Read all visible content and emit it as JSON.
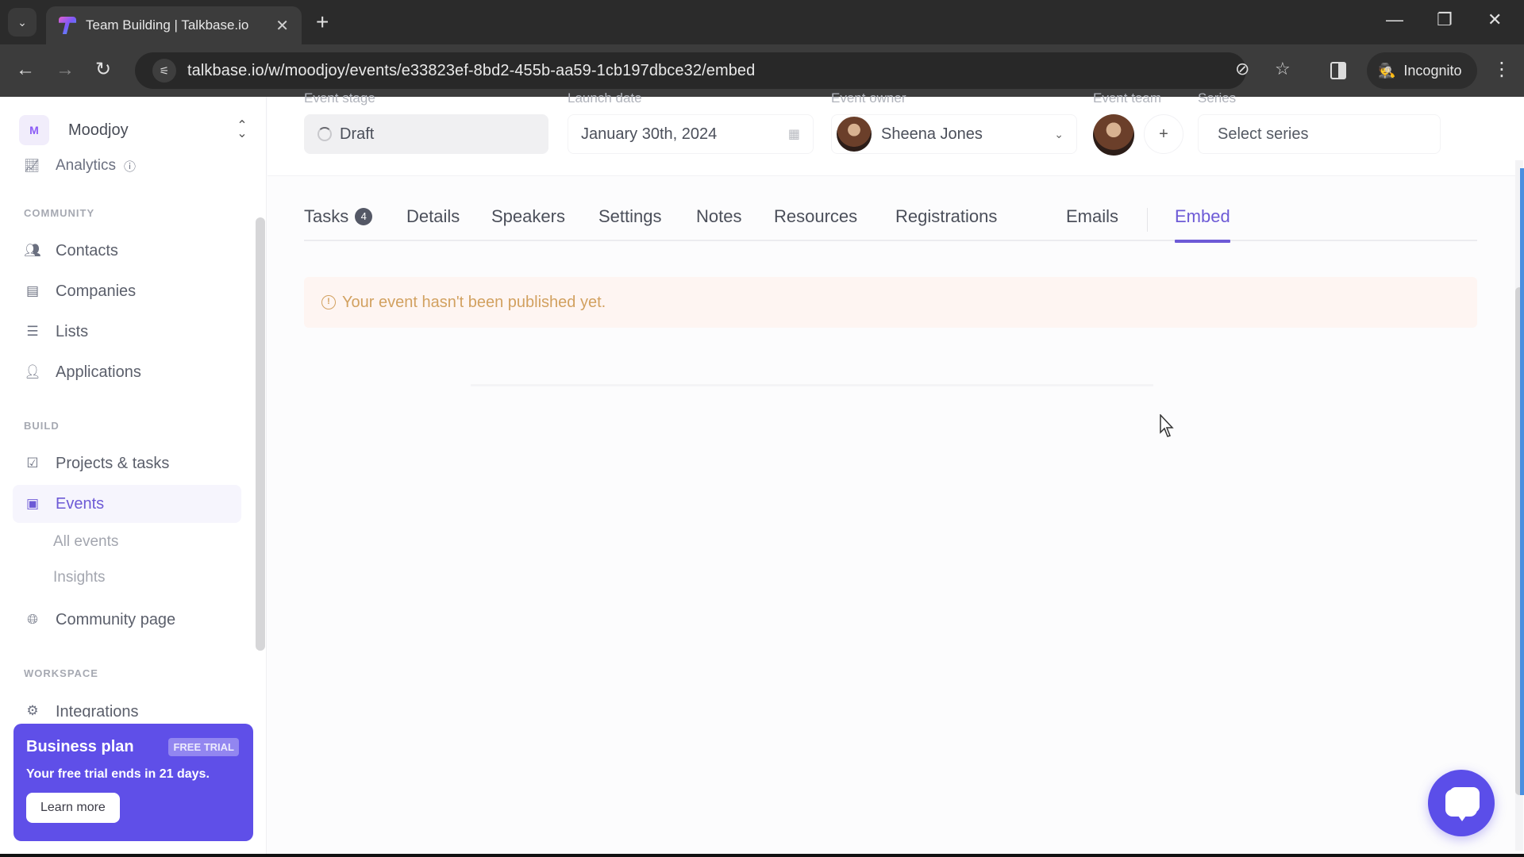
{
  "browser": {
    "tab_title": "Team Building | Talkbase.io",
    "url": "talkbase.io/w/moodjoy/events/e33823ef-8bd2-455b-aa59-1cb197dbce32/embed",
    "incognito_label": "Incognito",
    "icons": {
      "tab_search": "chevron-down-icon",
      "new_tab": "plus-icon",
      "back": "arrow-left-icon",
      "forward": "arrow-right-icon",
      "reload": "reload-icon",
      "site_info": "tune-icon",
      "eye_off": "eye-off-icon",
      "bookmark": "star-icon",
      "side_panel": "side-panel-icon",
      "menu": "more-vertical-icon"
    }
  },
  "sidebar": {
    "workspace": {
      "initial": "M",
      "name": "Moodjoy"
    },
    "analytics_label": "Analytics",
    "sections": {
      "community": "COMMUNITY",
      "build": "BUILD",
      "workspace": "WORKSPACE"
    },
    "community_items": [
      {
        "label": "Contacts",
        "icon": "users-icon"
      },
      {
        "label": "Companies",
        "icon": "book-icon"
      },
      {
        "label": "Lists",
        "icon": "list-icon"
      },
      {
        "label": "Applications",
        "icon": "user-plus-icon"
      }
    ],
    "build_items": [
      {
        "label": "Projects & tasks",
        "icon": "check-square-icon"
      },
      {
        "label": "Events",
        "icon": "calendar-icon",
        "active": true
      },
      {
        "label": "Community page",
        "icon": "globe-icon"
      }
    ],
    "events_subitems": [
      "All events",
      "Insights"
    ],
    "workspace_items": [
      {
        "label": "Integrations",
        "icon": "plug-icon"
      }
    ],
    "trial": {
      "title": "Business plan",
      "badge": "FREE TRIAL",
      "text": "Your free trial ends in 21 days.",
      "button": "Learn more"
    }
  },
  "event_header": {
    "labels": {
      "stage": "Event stage",
      "launch_date": "Launch date",
      "owner": "Event owner",
      "team": "Event team",
      "series": "Series"
    },
    "stage": "Draft",
    "launch_date": "January 30th, 2024",
    "owner": "Sheena Jones",
    "series_placeholder": "Select series",
    "add_team_label": "+"
  },
  "tabs": [
    {
      "label": "Tasks",
      "badge": "4"
    },
    {
      "label": "Details"
    },
    {
      "label": "Speakers"
    },
    {
      "label": "Settings"
    },
    {
      "label": "Notes"
    },
    {
      "label": "Resources"
    },
    {
      "label": "Registrations"
    },
    {
      "label": "Emails"
    },
    {
      "label": "Embed",
      "active": true
    }
  ],
  "alert": {
    "icon_glyph": "!",
    "text": "Your event hasn't been published yet."
  },
  "colors": {
    "accent": "#6d5ad6",
    "trial_bg": "#5f4fe8",
    "alert_text": "#d2a160",
    "alert_bg": "#fef5f2",
    "chat_fab": "#5b4ee9"
  }
}
